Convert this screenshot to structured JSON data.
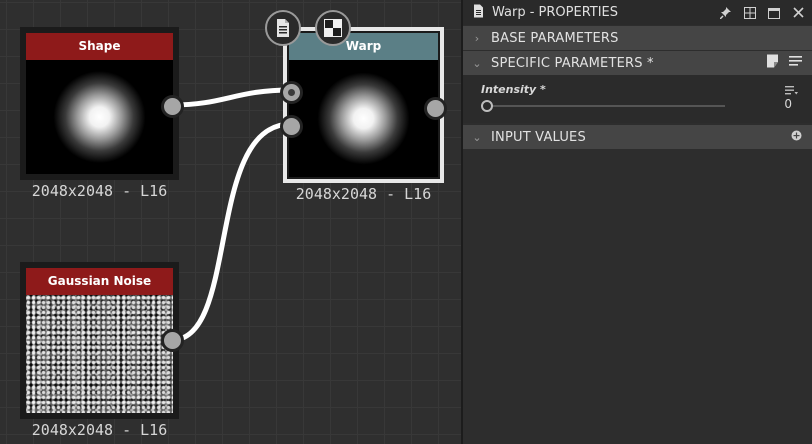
{
  "graph": {
    "nodes": {
      "shape": {
        "title": "Shape",
        "resolution": "2048x2048 - L16",
        "header_color": "#8e1a1a"
      },
      "warp": {
        "title": "Warp",
        "resolution": "2048x2048 - L16",
        "header_color": "#5b7f86"
      },
      "noise": {
        "title": "Gaussian Noise",
        "resolution": "2048x2048 - L16",
        "header_color": "#8e1a1a"
      }
    },
    "toolbar": {
      "icons": [
        "document-icon",
        "checker-icon"
      ]
    }
  },
  "panel": {
    "title": "Warp - PROPERTIES",
    "title_icons": [
      "document-icon",
      "pin-icon",
      "layout-icon",
      "maximize-icon",
      "close-icon"
    ],
    "sections": {
      "base": {
        "label": "BASE PARAMETERS",
        "expanded": false
      },
      "specific": {
        "label": "SPECIFIC PARAMETERS *",
        "expanded": true
      },
      "input": {
        "label": "INPUT VALUES",
        "expanded": true
      }
    },
    "params": [
      {
        "name": "Intensity *",
        "value": "0",
        "slider_fraction": 0
      }
    ]
  }
}
